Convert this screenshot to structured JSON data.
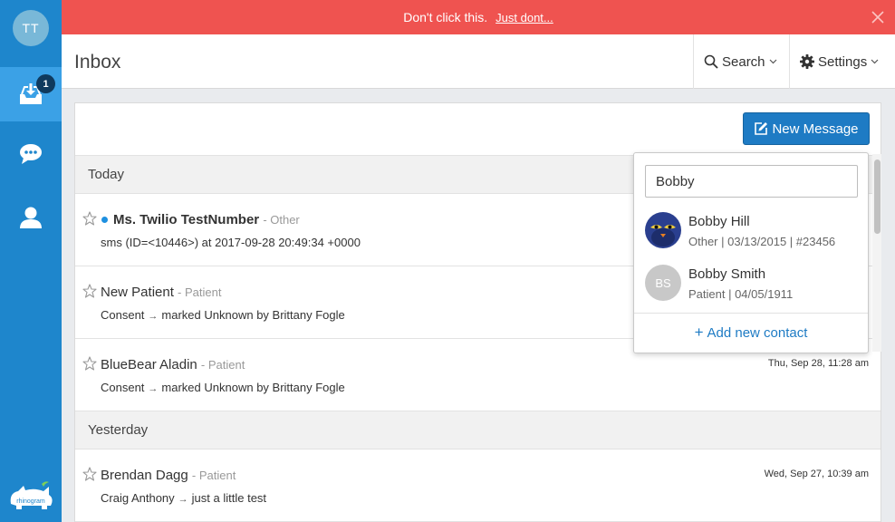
{
  "sidebar": {
    "avatar_initials": "TT",
    "inbox_badge": "1",
    "logo_text": "rhinogram"
  },
  "banner": {
    "message": "Don't click this.",
    "link_text": "Just dont..."
  },
  "header": {
    "title": "Inbox",
    "search_label": "Search",
    "settings_label": "Settings"
  },
  "toolbar": {
    "new_message_label": "New Message"
  },
  "sections": [
    {
      "label": "Today",
      "rows": [
        {
          "name": "Ms. Twilio TestNumber",
          "type": "- Other",
          "preview": "sms (ID=<10446>) at 2017-09-28 20:49:34 +0000",
          "time": ""
        },
        {
          "name": "New Patient",
          "type": "- Patient",
          "preview_from": "Consent",
          "preview": "marked Unknown by Brittany Fogle",
          "time": ""
        },
        {
          "name": "BlueBear Aladin",
          "type": "- Patient",
          "preview_from": "Consent",
          "preview": "marked Unknown by Brittany Fogle",
          "time": "Thu, Sep 28, 11:28 am"
        }
      ]
    },
    {
      "label": "Yesterday",
      "rows": [
        {
          "name": "Brendan Dagg",
          "type": "- Patient",
          "preview_from": "Craig Anthony",
          "preview": "just a little test",
          "time": "Wed, Sep 27, 10:39 am"
        }
      ]
    }
  ],
  "contact_search": {
    "query": "Bobby",
    "results": [
      {
        "name": "Bobby Hill",
        "meta": "Other | 03/13/2015 | #23456"
      },
      {
        "name": "Bobby Smith",
        "initials": "BS",
        "meta": "Patient | 04/05/1911"
      }
    ],
    "add_label": "Add new contact"
  },
  "colors": {
    "sidebar": "#1e86cc",
    "sidebar_active": "#3ba1e6",
    "banner": "#ef5350",
    "primary_button": "#1e7bc4",
    "unread_dot": "#1e90e0"
  }
}
